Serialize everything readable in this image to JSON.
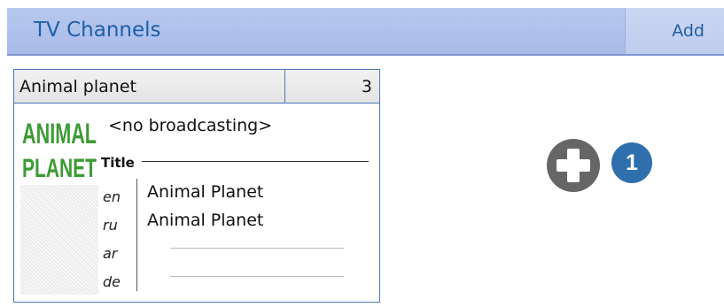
{
  "header": {
    "title": "TV Channels",
    "add_label": "Add"
  },
  "channel": {
    "name": "Animal planet",
    "count": "3",
    "logo_lines": [
      "ANIMAL",
      "PLANET"
    ],
    "status": "<no broadcasting>",
    "title_label": "Title",
    "titles": [
      {
        "lang": "en",
        "value": "Animal Planet"
      },
      {
        "lang": "ru",
        "value": "Animal Planet"
      },
      {
        "lang": "ar",
        "value": ""
      },
      {
        "lang": "de",
        "value": ""
      }
    ]
  },
  "actions": {
    "add_icon": "plus-circle-icon",
    "badge_number": "1"
  },
  "colors": {
    "header_bg": "#b7c7ee",
    "accent_blue": "#1f5fa8",
    "card_border": "#4b78b8",
    "logo_green": "#3d9b35",
    "plus_icon_gray": "#666666",
    "badge_blue": "#2f6fad"
  }
}
